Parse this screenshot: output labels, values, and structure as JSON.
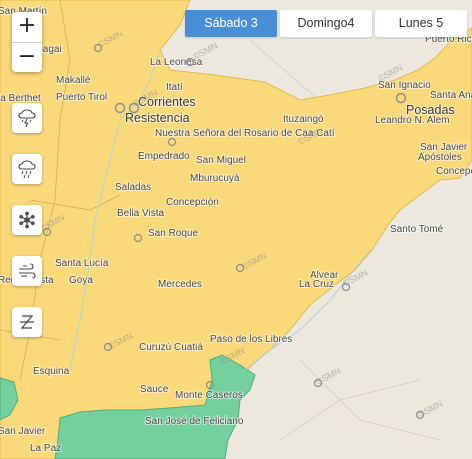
{
  "map": {
    "zoom_in": "+",
    "zoom_out": "−",
    "watermark": "©SMN",
    "colors": {
      "yellow_alert": "#fad97a",
      "green_alert": "#74d09e",
      "base": "#ece8dd",
      "water": "#aad3df"
    }
  },
  "days": [
    {
      "label": "Sábado 3",
      "active": true
    },
    {
      "label": "Domingo4",
      "active": false
    },
    {
      "label": "Lunes 5",
      "active": false
    }
  ],
  "layers": [
    {
      "icon": "thunderstorm-icon"
    },
    {
      "icon": "rain-icon"
    },
    {
      "icon": "snow-icon"
    },
    {
      "icon": "wind-icon"
    },
    {
      "icon": "zonda-icon"
    }
  ],
  "places": {
    "san_martin": "San Martín",
    "chagai": "Chagai",
    "makalle": "Makallé",
    "puerto_tirol": "Puerto Tirol",
    "la_berthet": "la Berthet",
    "la_leonesa": "La Leonesa",
    "itati": "Itatí",
    "corrientes": "Corrientes",
    "resistencia": "Resistencia",
    "ituzaingo": "Ituzaingó",
    "san_ignacio": "San Ignacio",
    "puerto_rico": "Puerto Rico",
    "santa_ana": "Santa Ana",
    "posadas": "Posadas",
    "leandro_n_alem": "Leandro N. Alem",
    "san_javier_ne": "San Javier",
    "apostoles": "Apóstoles",
    "concepcion_ne": "Concepci",
    "nuestra_senora": "Nuestra Señora del Rosario de Caa Catí",
    "empedrado": "Empedrado",
    "san_miguel": "San Miguel",
    "mburucuya": "Mburucuyá",
    "saladas": "Saladas",
    "concepcion": "Concepción",
    "bella_vista": "Bella Vista",
    "san_roque": "San Roque",
    "santo_tome": "Santo Tomé",
    "santa_lucia": "Santa Lucía",
    "goya": "Goya",
    "reconquista": "Reconquista",
    "mercedes": "Mercedes",
    "alvear": "Alvear",
    "la_cruz": "La Cruz",
    "paso_de_los_libres": "Paso de los Libres",
    "curuzu_cuatia": "Curuzú Cuatiá",
    "esquina": "Esquina",
    "sauce": "Sauce",
    "monte_caseros": "Monte Caseros",
    "san_jose_feliciano": "San José de Feliciano",
    "san_javier_sw": "San Javier",
    "la_paz": "La Paz"
  }
}
